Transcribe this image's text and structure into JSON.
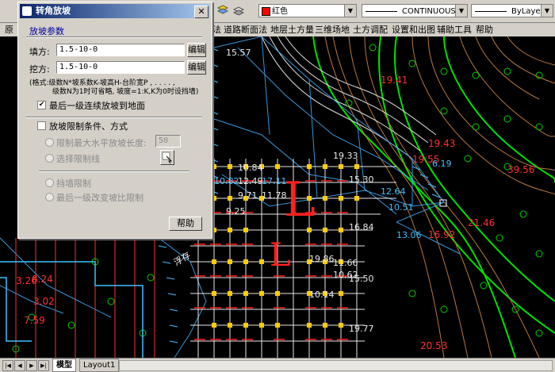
{
  "toolbar": {
    "color_value": "红色",
    "linetype_value": "CONTINUOUS",
    "lineweight_value": "ByLayer",
    "accent": "#ff0000"
  },
  "menu": {
    "items": [
      "原",
      "法",
      "道路断面法",
      "地层土方量",
      "三维场地",
      "土方调配",
      "设置和出图",
      "辅助工具",
      "帮助"
    ]
  },
  "dialog": {
    "title": "转角放坡",
    "group_label": "放坡参数",
    "fill_label": "填方:",
    "fill_value": "1.5-10-0",
    "cut_label": "挖方:",
    "cut_value": "1.5-10-0",
    "edit_label": "编辑",
    "format_note_1": "(格式:级数N*坡系数K-坡高H-台阶宽P , . . . . ,",
    "format_note_2": "级数N为1时可省略, 坡度=1:K,K为0时设挡墙)",
    "last_level_label": "最后一级连续放坡到地面",
    "last_level_checked": true,
    "limit_label": "放坡限制条件、方式",
    "limit_checked": false,
    "max_len_label": "限制最大水平放坡长度:",
    "max_len_value": "50",
    "select_line_label": "选择限制线",
    "wall_label": "挡墙限制",
    "last_level_ratio_label": "最后一级改变坡比限制",
    "help_label": "帮助"
  },
  "drawing": {
    "labels_white": [
      "15.57",
      "19.33",
      "9.25",
      "11.66",
      "10.62",
      "10.14",
      "11.78",
      "12.49",
      "9.71",
      "10.84",
      "15.30",
      "16.84",
      "19.86",
      "15.50",
      "19.77"
    ],
    "labels_red": [
      "3.26",
      "8.24",
      "3.02",
      "7.59",
      "19.41",
      "19.43",
      "39.56",
      "19.55",
      "16.92",
      "21.46",
      "20.53"
    ],
    "labels_cyan": [
      "12.64",
      "10.51",
      "17.11",
      "10.82",
      "6.19",
      "13.06"
    ],
    "big_labels": [
      "L",
      "L"
    ],
    "annotation": "浮存"
  },
  "bottom": {
    "tab_model": "模型",
    "tab_layout": "Layout1"
  }
}
